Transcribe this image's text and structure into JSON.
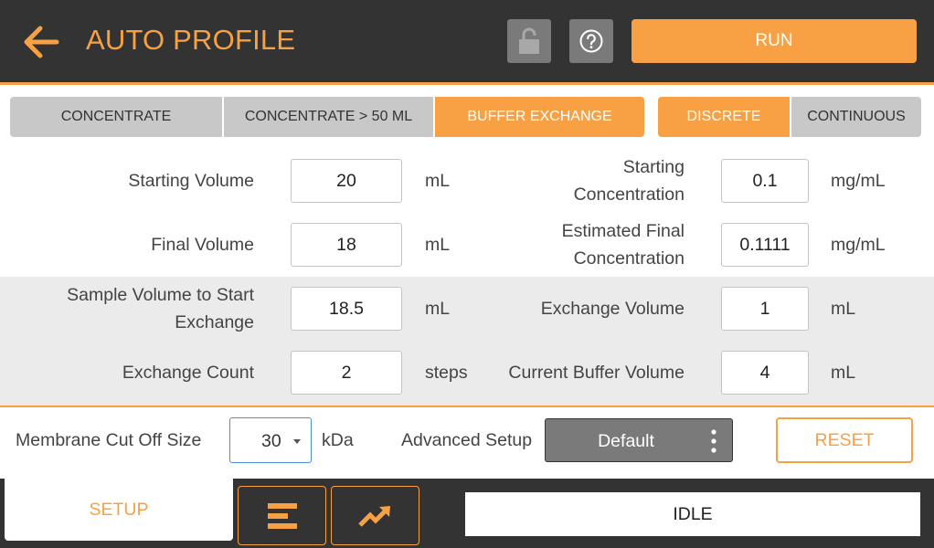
{
  "header": {
    "title": "AUTO PROFILE",
    "run_label": "RUN"
  },
  "mode_tabs": [
    {
      "label": "CONCENTRATE",
      "active": false
    },
    {
      "label": "CONCENTRATE > 50 ML",
      "active": false
    },
    {
      "label": "BUFFER EXCHANGE",
      "active": true
    }
  ],
  "exchange_tabs": [
    {
      "label": "DISCRETE",
      "active": true
    },
    {
      "label": "CONTINUOUS",
      "active": false
    }
  ],
  "form": {
    "starting_volume": {
      "label": "Starting Volume",
      "value": "20",
      "unit": "mL"
    },
    "final_volume": {
      "label": "Final Volume",
      "value": "18",
      "unit": "mL"
    },
    "sample_volume": {
      "label_line1": "Sample Volume to Start",
      "label_line2": "Exchange",
      "value": "18.5",
      "unit": "mL"
    },
    "exchange_count": {
      "label": "Exchange Count",
      "value": "2",
      "unit": "steps"
    },
    "starting_concentration": {
      "label_line1": "Starting",
      "label_line2": "Concentration",
      "value": "0.1",
      "unit": "mg/mL"
    },
    "estimated_final_concentration": {
      "label_line1": "Estimated Final",
      "label_line2": "Concentration",
      "value": "0.1111",
      "unit": "mg/mL"
    },
    "exchange_volume": {
      "label": "Exchange Volume",
      "value": "1",
      "unit": "mL"
    },
    "current_buffer_volume": {
      "label": "Current Buffer Volume",
      "value": "4",
      "unit": "mL"
    }
  },
  "controls": {
    "membrane_label": "Membrane Cut Off Size",
    "membrane_value": "30",
    "membrane_unit": "kDa",
    "advanced_label": "Advanced Setup",
    "advanced_value": "Default",
    "reset_label": "RESET"
  },
  "footer": {
    "setup_label": "SETUP",
    "status": "IDLE"
  },
  "colors": {
    "accent": "#F7A144",
    "header_bg": "#333333",
    "tab_inactive": "#c8c8c8",
    "button_gray": "#7a7a7a",
    "shaded_row": "#ebebeb"
  },
  "icons": {
    "back": "arrow-left-icon",
    "lock": "unlock-icon",
    "help": "help-circle-icon",
    "more": "kebab-menu-icon",
    "dropdown": "chevron-down-icon",
    "list": "align-left-bars-icon",
    "trend": "trending-up-icon"
  }
}
